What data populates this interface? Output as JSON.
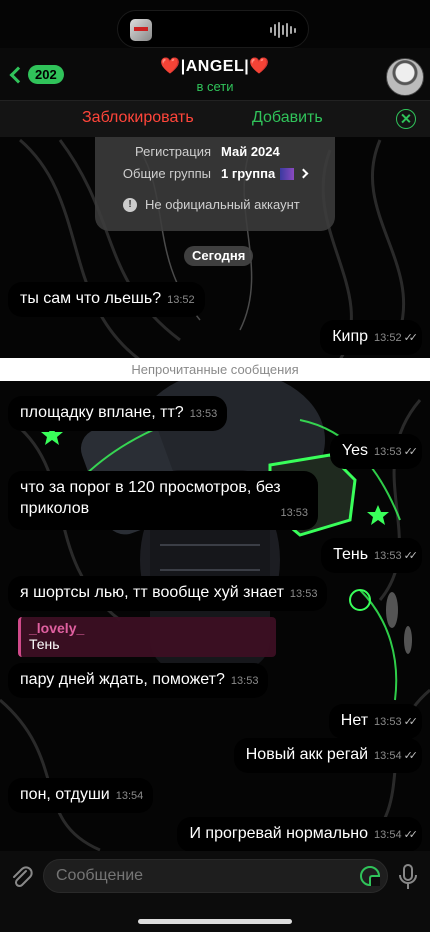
{
  "header": {
    "back_count": "202",
    "title": "|ANGEL|",
    "heart": "❤️",
    "status": "в сети"
  },
  "action_bar": {
    "block_label": "Заблокировать",
    "add_label": "Добавить"
  },
  "info_card": {
    "registration_label": "Регистрация",
    "registration_value": "Май 2024",
    "groups_label": "Общие группы",
    "groups_value": "1 группа",
    "unofficial_text": "Не официальный аккаунт"
  },
  "date_divider": "Сегодня",
  "unread_divider": "Непрочитанные сообщения",
  "messages": [
    {
      "text": "ты сам что льешь?",
      "time": "13:52"
    },
    {
      "text": "Кипр",
      "time": "13:52"
    },
    {
      "text": "площадку вплане, тт?",
      "time": "13:53"
    },
    {
      "text": "Yes",
      "time": "13:53"
    },
    {
      "text": "что за порог в 120 просмотров, без приколов",
      "time": "13:53"
    },
    {
      "text": "Тень",
      "time": "13:53"
    },
    {
      "text": "я шортсы лью, тт вообще хуй знает",
      "time": "13:53"
    },
    {
      "text": "пару дней ждать, поможет?",
      "time": "13:53"
    },
    {
      "text": "Нет",
      "time": "13:53"
    },
    {
      "text": "Новый акк регай",
      "time": "13:54"
    },
    {
      "text": "пон, отдуши",
      "time": "13:54"
    },
    {
      "text": "И прогревай нормально",
      "time": "13:54"
    }
  ],
  "reply": {
    "name": "_lovely_",
    "text": "Тень"
  },
  "input": {
    "placeholder": "Сообщение"
  },
  "colors": {
    "accent": "#30c35a",
    "danger": "#ff453a",
    "heart": "#e0242f"
  }
}
